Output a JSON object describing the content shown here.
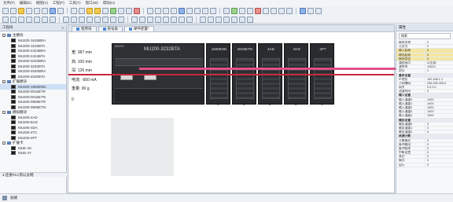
{
  "menubar": {
    "items": [
      "文件(F)",
      "编辑(E)",
      "视图(V)",
      "工程(P)",
      "工具(T)",
      "窗口(W)",
      "帮助(H)"
    ]
  },
  "left_panel": {
    "title": "工程树",
    "groups": [
      {
        "label": "主模块",
        "items": [
          "MU200-1616BRA",
          "MU200-1616BTA",
          "MU200-2424BRA",
          "MU200-2424BTA",
          "MU200-3232BRA",
          "MU200-3232BTA",
          "MU200-4040BRA",
          "MU200-4040BTA"
        ]
      },
      {
        "label": "扩展模块",
        "items": [
          "MU200-1600ENN",
          "MU200-0016ETR",
          "MU200-0016ETN",
          "MU200-0808ETR",
          "MU200-0808ETN"
        ]
      },
      {
        "label": "模拟模块",
        "items": [
          "MU200-4AD",
          "MU200-8AD",
          "MU200-4DA",
          "MU200-4TC",
          "MU200-4PT"
        ]
      },
      {
        "label": "扩展卡",
        "items": [
          "MUE-4X",
          "MUE-4Y"
        ]
      }
    ],
    "footer": "4.连接PLC到以太网"
  },
  "tabs": [
    {
      "label": "程序块"
    },
    {
      "label": "符号表"
    },
    {
      "label": "硬件配置*",
      "active": true
    }
  ],
  "props": [
    "宽: 387 mm",
    "高: 100 mm",
    "深: 126 mm",
    "电流: -950 mA",
    "重量: 00 g"
  ],
  "mark": "0",
  "plc": {
    "brand": "MICRO",
    "main_label": "MU200-3232BTA",
    "modules": [
      {
        "label": "1600ENN",
        "slot": "0"
      },
      {
        "label": "0016ETN",
        "slot": "1"
      },
      {
        "label": "4AD",
        "slot": "2"
      },
      {
        "label": "8AD",
        "slot": "3"
      },
      {
        "label": "4PT",
        "slot": "4"
      }
    ]
  },
  "right_panel": {
    "title": "属性",
    "search": "搜索",
    "rows": [
      {
        "k": "模块名称",
        "v": "0",
        "type": "normal"
      },
      {
        "k": "订货号",
        "v": "0",
        "type": "normal"
      },
      {
        "k": "输入起始",
        "v": "0",
        "type": "hl"
      },
      {
        "k": "输出起始",
        "v": "0",
        "type": "hl"
      },
      {
        "k": "模块类型",
        "v": "0",
        "type": "hl"
      },
      {
        "k": "通信接口",
        "v": "以太网",
        "type": "normal"
      },
      {
        "k": "波特率",
        "v": "19200",
        "type": "normal"
      },
      {
        "k": "站号",
        "v": "1",
        "type": "normal"
      },
      {
        "k": "基本设置",
        "v": "",
        "type": "sec"
      },
      {
        "k": "IP地址",
        "v": "192.168.1.1",
        "type": "normal"
      },
      {
        "k": "子网掩码",
        "v": "255.255.255.0",
        "type": "normal"
      },
      {
        "k": "网关",
        "v": "0.0.0.0",
        "type": "normal"
      },
      {
        "k": "滤波时间",
        "v": "0",
        "type": "normal"
      },
      {
        "k": "输入设置",
        "v": "",
        "type": "sec"
      },
      {
        "k": "输入通道0",
        "v": "1000",
        "type": "normal"
      },
      {
        "k": "输入通道1",
        "v": "1000",
        "type": "normal"
      },
      {
        "k": "输入通道2",
        "v": "1000",
        "type": "normal"
      },
      {
        "k": "输入通道3",
        "v": "1000",
        "type": "normal"
      },
      {
        "k": "输入通道4",
        "v": "1000",
        "type": "normal"
      },
      {
        "k": "输出设置",
        "v": "",
        "type": "sec"
      },
      {
        "k": "输出通道0",
        "v": "0",
        "type": "normal"
      },
      {
        "k": "输出通道1",
        "v": "0",
        "type": "normal"
      },
      {
        "k": "输出通道2",
        "v": "0",
        "type": "normal"
      },
      {
        "k": "高速计数",
        "v": "",
        "type": "sec"
      },
      {
        "k": "计数模式",
        "v": "0",
        "type": "normal"
      },
      {
        "k": "脉冲输出",
        "v": "0",
        "type": "normal"
      },
      {
        "k": "脉冲频率",
        "v": "0",
        "type": "normal"
      },
      {
        "k": "中断设置",
        "v": "0",
        "type": "normal"
      },
      {
        "k": "其它",
        "v": "0",
        "type": "normal"
      },
      {
        "k": "模式",
        "v": "0",
        "type": "normal"
      },
      {
        "k": "运行",
        "v": "0",
        "type": "normal"
      }
    ]
  },
  "statusbar": {
    "text": "就绪"
  }
}
